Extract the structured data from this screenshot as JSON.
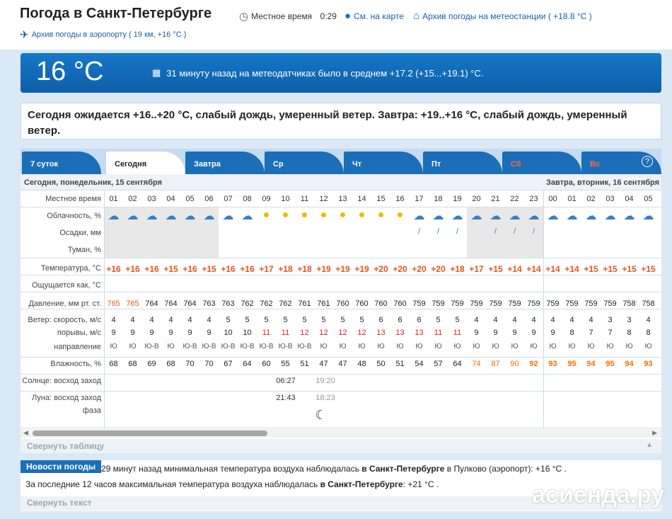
{
  "header": {
    "title": "Погода в Санкт-Петербурге",
    "local_time_label": "Местное время",
    "local_time": "0:29",
    "map_link": "См. на карте",
    "station_link": "Архив погоды на метеостанции ( +18.8 °C )",
    "airport_link": "Архив погоды в аэропорту ( 19 км, +16 °C )"
  },
  "now": {
    "temp": "16 °C",
    "desc": "31 минуту назад на метеодатчиках было в среднем +17.2 (+15...+19.1) °C."
  },
  "forecast": "Сегодня ожидается +16..+20 °C, слабый дождь, умеренный ветер. Завтра: +19..+16 °C, слабый дождь, умеренный ветер.",
  "tabs": [
    {
      "label": "7 суток"
    },
    {
      "label": "Сегодня"
    },
    {
      "label": "Завтра"
    },
    {
      "label": "Ср"
    },
    {
      "label": "Чт"
    },
    {
      "label": "Пт"
    },
    {
      "label": "Сб"
    },
    {
      "label": "Вс"
    }
  ],
  "help": "?",
  "day_today": "Сегодня, понедельник, 15 сентября",
  "day_tomorrow": "Завтра, вторник, 16 сентября",
  "labels": {
    "time": "Местное время",
    "cloud": "Облачность, %",
    "precip": "Осадки, мм",
    "fog": "Туман, %",
    "temp": "Температура, °C",
    "feels": "Ощущается как, °C",
    "pressure": "Давление, мм рт. ст.",
    "wind_speed": "Ветер: скорость, м/с",
    "gusts": "порывы, м/с",
    "direction": "направление",
    "humidity": "Влажность, %",
    "sun": "Солнце: восход заход",
    "moon": "Луна: восход заход",
    "phase": "фаза"
  },
  "hours": [
    "01",
    "02",
    "03",
    "04",
    "05",
    "06",
    "07",
    "08",
    "09",
    "10",
    "11",
    "12",
    "13",
    "14",
    "15",
    "16",
    "17",
    "18",
    "19",
    "20",
    "21",
    "22",
    "23",
    "00",
    "01",
    "02",
    "03",
    "04",
    "05"
  ],
  "temps": [
    "+16",
    "+16",
    "+16",
    "+15",
    "+16",
    "+15",
    "+16",
    "+16",
    "+17",
    "+18",
    "+18",
    "+19",
    "+19",
    "+19",
    "+20",
    "+20",
    "+20",
    "+20",
    "+18",
    "+17",
    "+15",
    "+14",
    "+14",
    "+14",
    "+14",
    "+15",
    "+15",
    "+15",
    "+15"
  ],
  "pressure": [
    "765",
    "765",
    "764",
    "764",
    "764",
    "763",
    "763",
    "762",
    "762",
    "762",
    "761",
    "761",
    "760",
    "760",
    "760",
    "760",
    "759",
    "759",
    "759",
    "759",
    "759",
    "759",
    "759",
    "759",
    "759",
    "759",
    "759",
    "758",
    "758"
  ],
  "wind": [
    "4",
    "4",
    "4",
    "4",
    "4",
    "4",
    "5",
    "5",
    "5",
    "5",
    "5",
    "5",
    "5",
    "5",
    "6",
    "6",
    "6",
    "5",
    "5",
    "4",
    "4",
    "4",
    "4",
    "4",
    "4",
    "4",
    "3",
    "3",
    "4"
  ],
  "gusts": [
    "9",
    "9",
    "9",
    "9",
    "9",
    "9",
    "10",
    "10",
    "11",
    "11",
    "12",
    "12",
    "12",
    "12",
    "13",
    "13",
    "13",
    "11",
    "11",
    "9",
    "9",
    "9",
    "9",
    "9",
    "8",
    "7",
    "7",
    "8",
    "8"
  ],
  "direction": [
    "Ю",
    "Ю",
    "Ю-В",
    "Ю",
    "Ю-В",
    "Ю-В",
    "Ю-В",
    "Ю-В",
    "Ю-В",
    "Ю-В",
    "Ю-В",
    "Ю",
    "Ю",
    "Ю",
    "Ю",
    "Ю",
    "Ю",
    "Ю",
    "Ю",
    "Ю",
    "Ю",
    "Ю",
    "Ю",
    "Ю",
    "Ю",
    "Ю",
    "Ю",
    "Ю",
    "Ю"
  ],
  "humidity": [
    "68",
    "68",
    "69",
    "68",
    "70",
    "70",
    "67",
    "64",
    "60",
    "55",
    "51",
    "47",
    "47",
    "48",
    "50",
    "51",
    "54",
    "57",
    "64",
    "74",
    "87",
    "90",
    "92",
    "93",
    "95",
    "94",
    "95",
    "94",
    "93"
  ],
  "sun": {
    "rise": "06:27",
    "set": "19:20"
  },
  "moon": {
    "rise": "21:43",
    "set": "18:23"
  },
  "collapse_table": "Свернуть таблицу",
  "news": {
    "title": "Новости погоды",
    "l1a": "29 минут назад минимальная температура воздуха наблюдалась ",
    "l1b": "в Санкт-Петербурге",
    "l1c": " в Пулково (аэропорт): +16 °C .",
    "l2a": "За последние 12 часов максимальная температура воздуха наблюдалась ",
    "l2b": "в Санкт-Петербурге",
    "l2c": ": +21 °C .",
    "collapse": "Свернуть текст"
  },
  "watermark": "асиенда.ру",
  "colors": {
    "accent": "#1a6fb8",
    "temp": "#e8531a",
    "alert": "#d0231f",
    "humid": "#ff6a00"
  }
}
